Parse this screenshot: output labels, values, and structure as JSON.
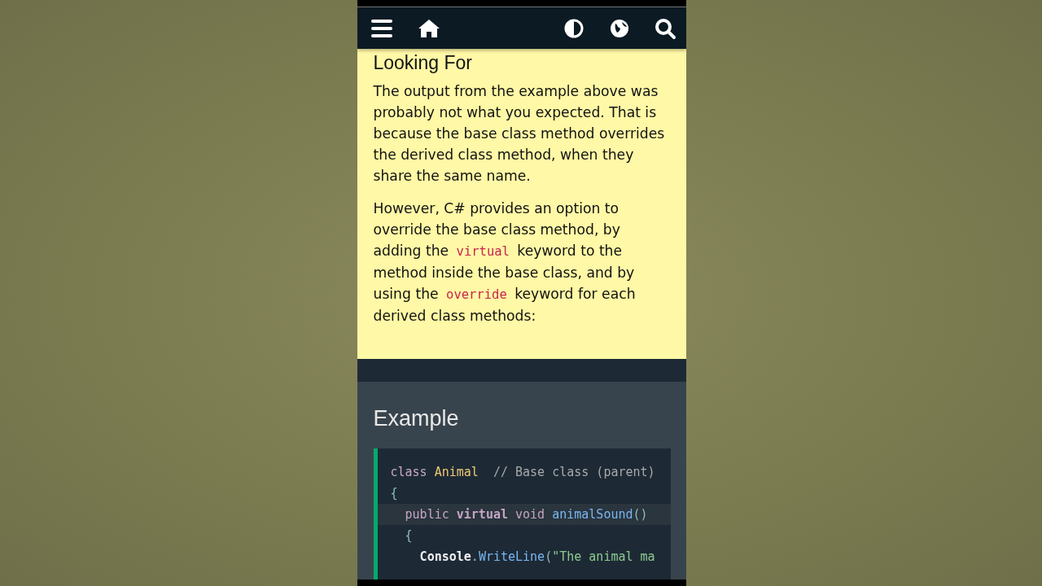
{
  "navbar": {
    "icons": [
      {
        "kind": "menu"
      },
      {
        "kind": "home"
      },
      {
        "kind": "contrast"
      },
      {
        "kind": "globe"
      },
      {
        "kind": "search"
      }
    ]
  },
  "section": {
    "heading": "Looking For",
    "paragraphs": [
      [
        {
          "text": "The output from the example above was probably not what you expected. That is because the base class method overrides the derived class method, when they share the same name.",
          "code": false
        }
      ],
      [
        {
          "text": "However, C# provides an option to override the base class method, by adding the ",
          "code": false
        },
        {
          "text": "virtual",
          "code": true
        },
        {
          "text": " keyword to the method inside the base class, and by using the ",
          "code": false
        },
        {
          "text": "override",
          "code": true
        },
        {
          "text": " keyword for each derived class methods:",
          "code": false
        }
      ]
    ]
  },
  "example": {
    "heading": "Example",
    "code_lines": [
      {
        "highlighted": false,
        "tokens": [
          {
            "text": "class ",
            "kind": "keyword"
          },
          {
            "text": "Animal",
            "kind": "type"
          },
          {
            "text": "  // Base class (parent)",
            "kind": "comment"
          }
        ]
      },
      {
        "highlighted": false,
        "tokens": [
          {
            "text": "{",
            "kind": "plain"
          }
        ]
      },
      {
        "highlighted": true,
        "tokens": [
          {
            "text": "  public ",
            "kind": "keyword"
          },
          {
            "text": "virtual",
            "kind": "keyword-bold"
          },
          {
            "text": " void ",
            "kind": "keyword"
          },
          {
            "text": "animalSound",
            "kind": "method"
          },
          {
            "text": "()",
            "kind": "plain"
          }
        ]
      },
      {
        "highlighted": false,
        "tokens": [
          {
            "text": "  {",
            "kind": "plain"
          }
        ]
      },
      {
        "highlighted": false,
        "tokens": [
          {
            "text": "    Console",
            "kind": "object"
          },
          {
            "text": ".",
            "kind": "plain"
          },
          {
            "text": "WriteLine",
            "kind": "method"
          },
          {
            "text": "(",
            "kind": "plain"
          },
          {
            "text": "\"The animal ma",
            "kind": "string"
          }
        ]
      }
    ]
  }
}
